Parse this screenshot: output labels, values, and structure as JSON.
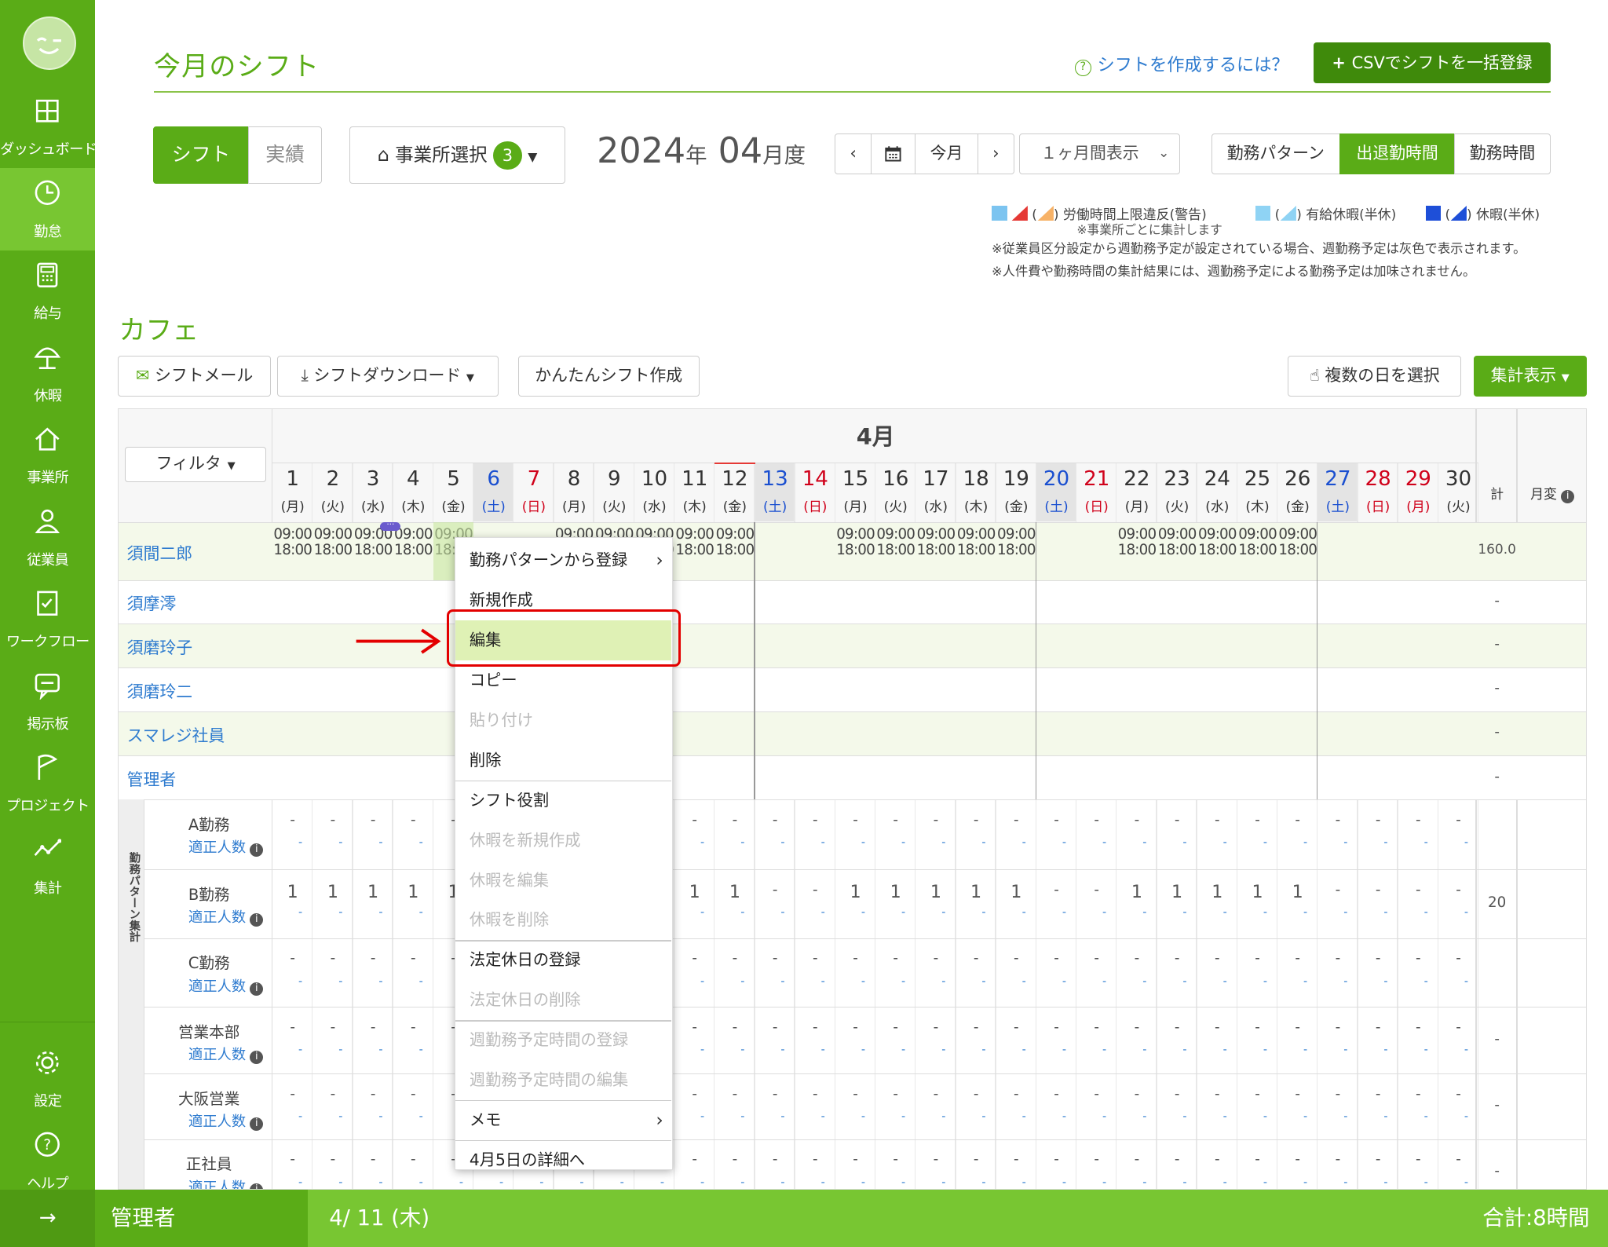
{
  "header": {
    "title": "今月のシフト",
    "help_link": "シフトを作成するには？",
    "csv_button": "CSVでシフトを一括登録"
  },
  "toolbar": {
    "tab_shift": "シフト",
    "tab_actual": "実績",
    "office_select": "事業所選択",
    "office_count": "3",
    "year": "2024",
    "year_unit": "年",
    "month": "04",
    "month_unit": "月度",
    "today": "今月",
    "period": "１ヶ月間表示",
    "view_pattern": "勤務パターン",
    "view_inout": "出退勤時間",
    "view_hours": "勤務時間"
  },
  "legend": {
    "overtime": "労働時間上限違反(警告)",
    "paid_leave": "有給休暇(半休)",
    "leave": "休暇(半休)",
    "note_office": "※事業所ごとに集計します",
    "note1": "※従業員区分設定から週勤務予定が設定されている場合、週勤務予定は灰色で表示されます。",
    "note2": "※人件費や勤務時間の集計結果には、週勤務予定による勤務予定は加味されません。",
    "paren_open": "(",
    "paren_close": ")",
    "colors": {
      "overtime": "#e53935",
      "paid": "#8fd3f4",
      "leave": "#1e4fd8"
    }
  },
  "section": {
    "title": "カフェ",
    "shift_mail": "シフトメール",
    "shift_download": "シフトダウンロード",
    "easy_create": "かんたんシフト作成",
    "multi_select": "複数の日を選択",
    "summary": "集計表示"
  },
  "table": {
    "month_label": "4月",
    "filter": "フィルタ",
    "total_col": "計",
    "monthly_col": "月変",
    "days": [
      {
        "d": "1",
        "w": "(月)"
      },
      {
        "d": "2",
        "w": "(火)"
      },
      {
        "d": "3",
        "w": "(水)"
      },
      {
        "d": "4",
        "w": "(木)"
      },
      {
        "d": "5",
        "w": "(金)"
      },
      {
        "d": "6",
        "w": "(土)"
      },
      {
        "d": "7",
        "w": "(日)"
      },
      {
        "d": "8",
        "w": "(月)"
      },
      {
        "d": "9",
        "w": "(火)"
      },
      {
        "d": "10",
        "w": "(水)"
      },
      {
        "d": "11",
        "w": "(木)"
      },
      {
        "d": "12",
        "w": "(金)"
      },
      {
        "d": "13",
        "w": "(土)"
      },
      {
        "d": "14",
        "w": "(日)"
      },
      {
        "d": "15",
        "w": "(月)"
      },
      {
        "d": "16",
        "w": "(火)"
      },
      {
        "d": "17",
        "w": "(水)"
      },
      {
        "d": "18",
        "w": "(木)"
      },
      {
        "d": "19",
        "w": "(金)"
      },
      {
        "d": "20",
        "w": "(土)"
      },
      {
        "d": "21",
        "w": "(日)"
      },
      {
        "d": "22",
        "w": "(月)"
      },
      {
        "d": "23",
        "w": "(火)"
      },
      {
        "d": "24",
        "w": "(水)"
      },
      {
        "d": "25",
        "w": "(木)"
      },
      {
        "d": "26",
        "w": "(金)"
      },
      {
        "d": "27",
        "w": "(土)"
      },
      {
        "d": "28",
        "w": "(日)"
      },
      {
        "d": "29",
        "w": "(月)"
      },
      {
        "d": "30",
        "w": "(火)"
      }
    ],
    "employees": [
      "須間二郎",
      "須摩澪",
      "須磨玲子",
      "須磨玲二",
      "スマレジ社員",
      "管理者"
    ],
    "shift_start": "09:00",
    "shift_end": "18:00",
    "work_days": [
      "1",
      "2",
      "3",
      "4",
      "5",
      "8",
      "9",
      "10",
      "11",
      "12",
      "15",
      "16",
      "17",
      "18",
      "19",
      "22",
      "23",
      "24",
      "25",
      "26"
    ],
    "emp_totals": [
      "160.0",
      "-",
      "-",
      "-",
      "-",
      "-"
    ],
    "group_label": "勤務パターン集計",
    "patterns": [
      {
        "name": "A勤務",
        "sub": "適正人数",
        "total": ""
      },
      {
        "name": "B勤務",
        "sub": "適正人数",
        "total": "20"
      },
      {
        "name": "C勤務",
        "sub": "適正人数",
        "total": ""
      },
      {
        "name": "営業本部",
        "sub": "適正人数",
        "total": "-"
      },
      {
        "name": "大阪営業",
        "sub": "適正人数",
        "total": "-"
      },
      {
        "name": "正社員",
        "sub": "適正人数",
        "total": "-"
      }
    ],
    "one": "1",
    "dash": "-",
    "info": "i"
  },
  "context_menu": [
    {
      "label": "勤務パターンから登録",
      "enabled": true,
      "submenu": true
    },
    {
      "label": "新規作成",
      "enabled": true
    },
    {
      "label": "編集",
      "enabled": true,
      "highlighted": true
    },
    {
      "label": "コピー",
      "enabled": true
    },
    {
      "label": "貼り付け",
      "enabled": false
    },
    {
      "label": "削除",
      "enabled": true
    },
    {
      "label": "シフト役割",
      "enabled": true
    },
    {
      "label": "休暇を新規作成",
      "enabled": false
    },
    {
      "label": "休暇を編集",
      "enabled": false
    },
    {
      "label": "休暇を削除",
      "enabled": false
    },
    {
      "label": "法定休日の登録",
      "enabled": true
    },
    {
      "label": "法定休日の削除",
      "enabled": false
    },
    {
      "label": "週勤務予定時間の登録",
      "enabled": false
    },
    {
      "label": "週勤務予定時間の編集",
      "enabled": false
    },
    {
      "label": "メモ",
      "enabled": true,
      "submenu": true
    },
    {
      "label": "4月5日の詳細へ",
      "enabled": true
    }
  ],
  "sidebar": {
    "items": [
      {
        "label": "ダッシュボード",
        "icon": "dashboard-icon"
      },
      {
        "label": "勤怠",
        "icon": "clock-icon",
        "active": true
      },
      {
        "label": "給与",
        "icon": "calculator-icon"
      },
      {
        "label": "休暇",
        "icon": "parasol-icon"
      },
      {
        "label": "事業所",
        "icon": "home-icon"
      },
      {
        "label": "従業員",
        "icon": "person-icon"
      },
      {
        "label": "ワークフロー",
        "icon": "checklist-icon"
      },
      {
        "label": "掲示板",
        "icon": "chat-icon"
      },
      {
        "label": "プロジェクト",
        "icon": "flag-icon"
      },
      {
        "label": "集計",
        "icon": "chart-icon"
      }
    ],
    "settings": "設定",
    "help": "ヘルプ",
    "expand": "→"
  },
  "footer": {
    "user": "管理者",
    "date": "4/ 11 (木)",
    "total": "合計:8時間"
  },
  "colors": {
    "accent": "#5aac17",
    "link": "#2e7bcf",
    "saturday": "#1a4fd0",
    "sunday": "#d0021b"
  }
}
